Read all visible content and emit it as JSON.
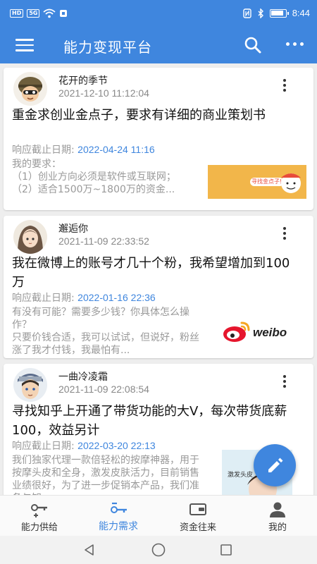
{
  "status_bar": {
    "left_badges": [
      "HD",
      "5G"
    ],
    "time": "8:44",
    "icons": [
      "wifi-icon",
      "nfc-icon",
      "bluetooth-icon",
      "battery-icon"
    ]
  },
  "app_bar": {
    "title": "能力变现平台",
    "icons": [
      "menu-icon",
      "search-icon",
      "more-icon"
    ]
  },
  "posts": [
    {
      "author": "花开的季节",
      "time": "2021-12-10 11:12:04",
      "title": "重金求创业金点子，要求有详细的商业策划书",
      "deadline_label": "响应截止日期:",
      "deadline_value": "2022-04-24 11:16",
      "description": "我的要求：\n（1）创业方向必须是软件或互联网；\n（2）适合1500万~1800万的资金...",
      "thumb_text": "寻找金点子!"
    },
    {
      "author": "邂逅你",
      "time": "2021-11-09 22:33:52",
      "title": "我在微博上的账号才几十个粉，我希望增加到100万",
      "deadline_label": "响应截止日期:",
      "deadline_value": "2022-01-16 22:36",
      "description": "有没有可能？需要多少钱？你具体怎么操作？\n只要价钱合适，我可以试试，但说好，粉丝涨了我才付钱，我最怕有...",
      "thumb_text": "weibo"
    },
    {
      "author": "一曲冷凌霜",
      "time": "2021-11-09 22:08:54",
      "title": "寻找知乎上开通了带货功能的大V，每次带货底薪100，效益另计",
      "deadline_label": "响应截止日期:",
      "deadline_value": "2022-03-20 22:13",
      "description": "我们独家代理一款倍轻松的按摩神器，用于按摩头皮和全身，激发皮肤活力，目前销售业绩很好，为了进一步促销本产品，我们准备与知",
      "thumb_text": "激发头皮"
    }
  ],
  "bottom_nav": [
    {
      "label": "能力供给",
      "icon": "key-plus-icon",
      "active": false
    },
    {
      "label": "能力需求",
      "icon": "key-minus-icon",
      "active": true
    },
    {
      "label": "资金往来",
      "icon": "wallet-icon",
      "active": false
    },
    {
      "label": "我的",
      "icon": "person-icon",
      "active": false
    }
  ],
  "colors": {
    "primary": "#3f86de",
    "text_primary": "#111111",
    "text_secondary": "#999999",
    "background": "#eeeeee"
  }
}
